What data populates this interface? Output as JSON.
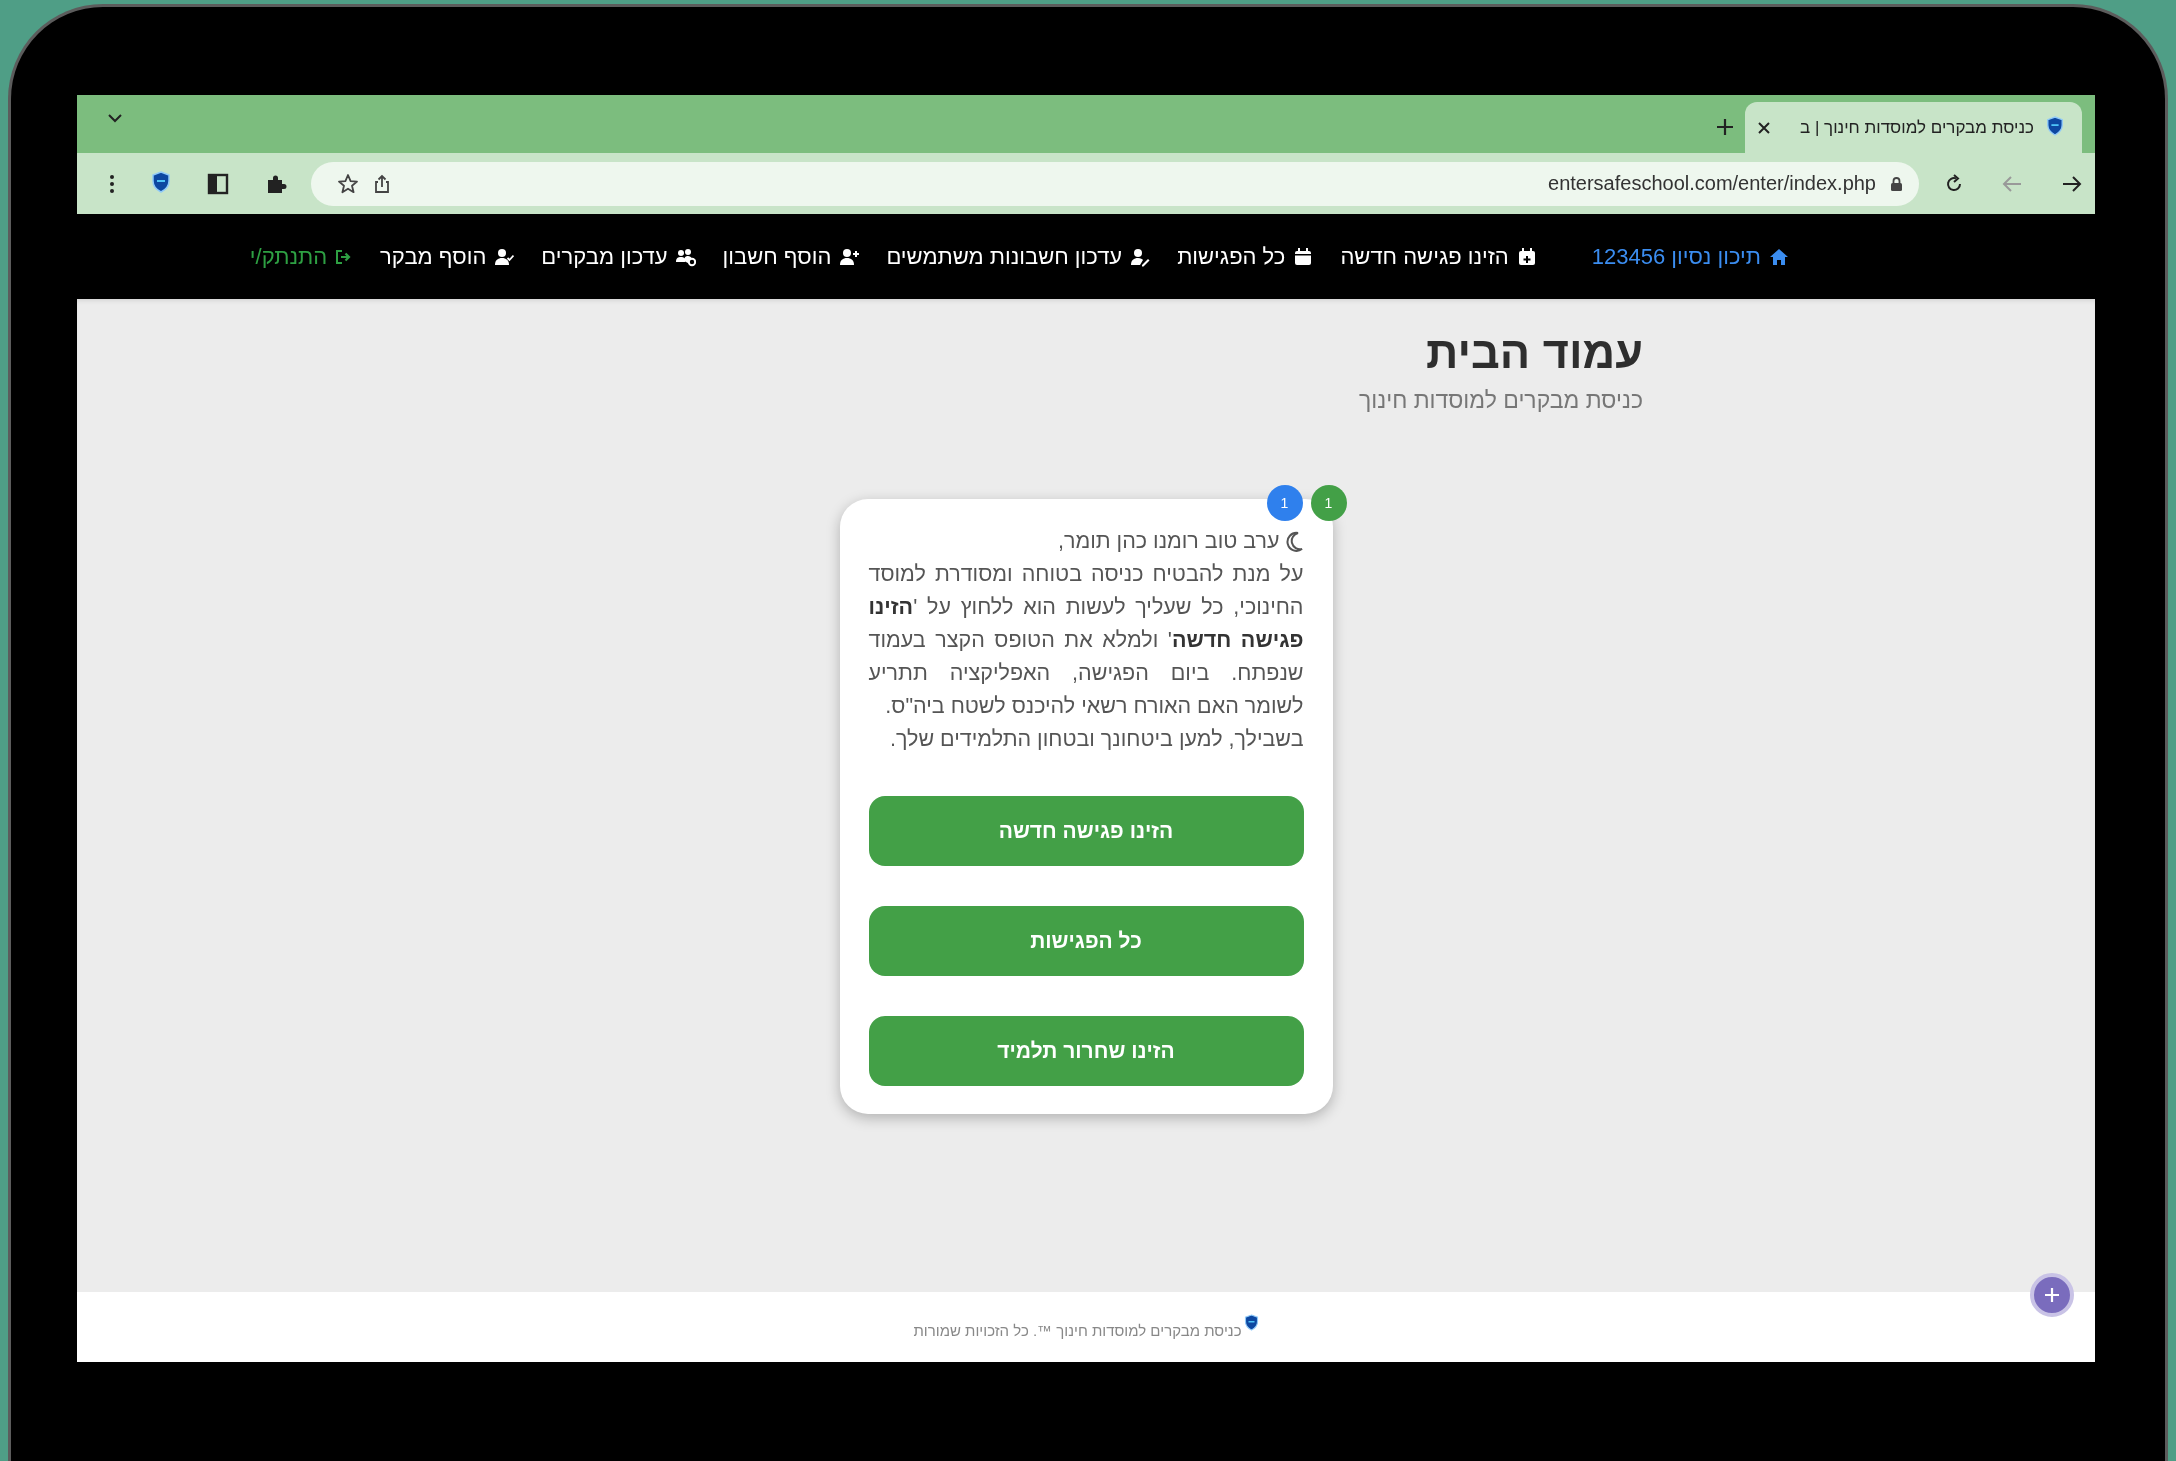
{
  "browser": {
    "tab": {
      "title": "כניסת מבקרים למוסדות חינוך | ב",
      "selected": true
    },
    "url": "entersafeschool.com/enter/index.php"
  },
  "navbar": {
    "brand": "תיכון נסיון 123456",
    "items": [
      {
        "label": "הזינו פגישה חדשה"
      },
      {
        "label": "כל הפגישות"
      },
      {
        "label": "עדכון חשבונות משתמשים"
      },
      {
        "label": "הוסף חשבון"
      },
      {
        "label": "עדכון מבקרים"
      },
      {
        "label": "הוסף מבקר"
      }
    ],
    "logout": "התנתק/י"
  },
  "page": {
    "title": "עמוד הבית",
    "subtitle": "כניסת מבקרים למוסדות חינוך"
  },
  "card": {
    "badges": [
      {
        "text": "1",
        "color": "#43a047"
      },
      {
        "text": "1",
        "color": "#2f80ed"
      }
    ],
    "greeting": "ערב טוב רומנו כהן תומר,",
    "paragraphs": [
      "על מנת להבטיח כניסה בטוחה ומסודרת למוסד החינוכי, כל שעליך לעשות הוא ללחוץ על '**הזינו פגישה חדשה**' ולמלא את הטופס הקצר בעמוד שנפתח. ביום הפגישה, האפליקציה תתריע לשומר האם האורח רשאי להיכנס לשטח ביה\"ס.",
      "בשבילך, למען ביטחונך ובטחון התלמידים שלך."
    ],
    "buttons": [
      "הזינו פגישה חדשה",
      "כל הפגישות",
      "הזינו שחרור תלמיד"
    ]
  },
  "footer": {
    "text": "כניסת מבקרים למוסדות חינוך ™. כל הזכויות שמורות"
  }
}
